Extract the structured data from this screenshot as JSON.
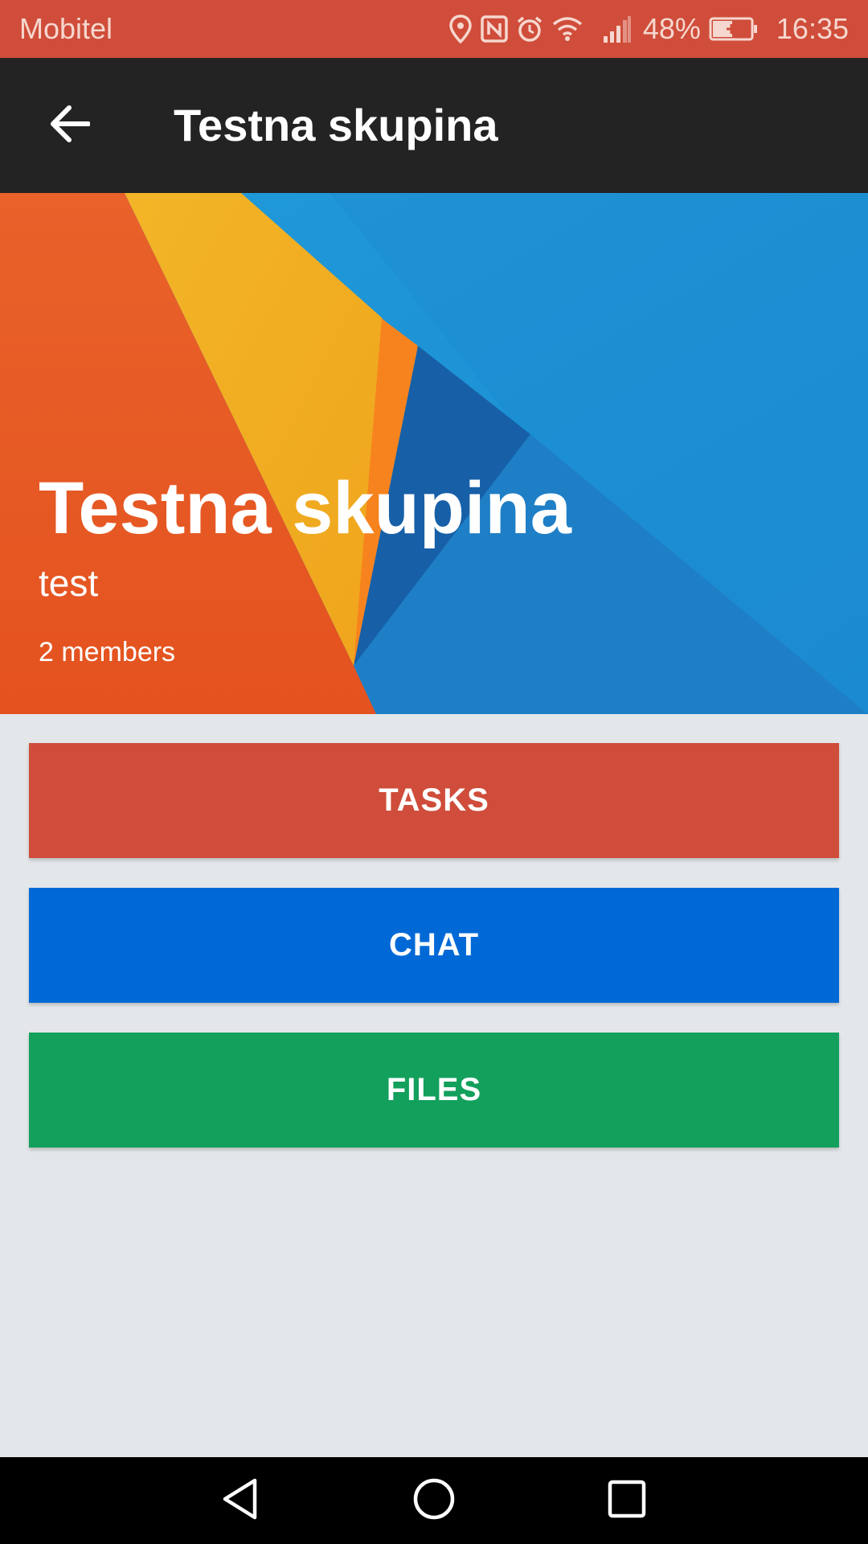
{
  "status_bar": {
    "carrier": "Mobitel",
    "battery": "48%",
    "time": "16:35",
    "icons": [
      "location-icon",
      "nfc-icon",
      "alarm-icon",
      "wifi-icon",
      "signal-icon",
      "battery-charging-icon"
    ]
  },
  "app_bar": {
    "title": "Testna skupina",
    "back_icon": "arrow-back-icon"
  },
  "hero": {
    "title": "Testna skupina",
    "subtitle": "test",
    "members": "2 members"
  },
  "actions": {
    "tasks": "TASKS",
    "chat": "CHAT",
    "files": "FILES"
  },
  "colors": {
    "status_bar": "#cf4d3a",
    "app_bar": "#232323",
    "tasks": "#cf4d3a",
    "chat": "#0069d6",
    "files": "#13a05c",
    "background": "#e3e7e9"
  },
  "nav_bar": {
    "icons": [
      "nav-back-icon",
      "nav-home-icon",
      "nav-recents-icon"
    ]
  }
}
